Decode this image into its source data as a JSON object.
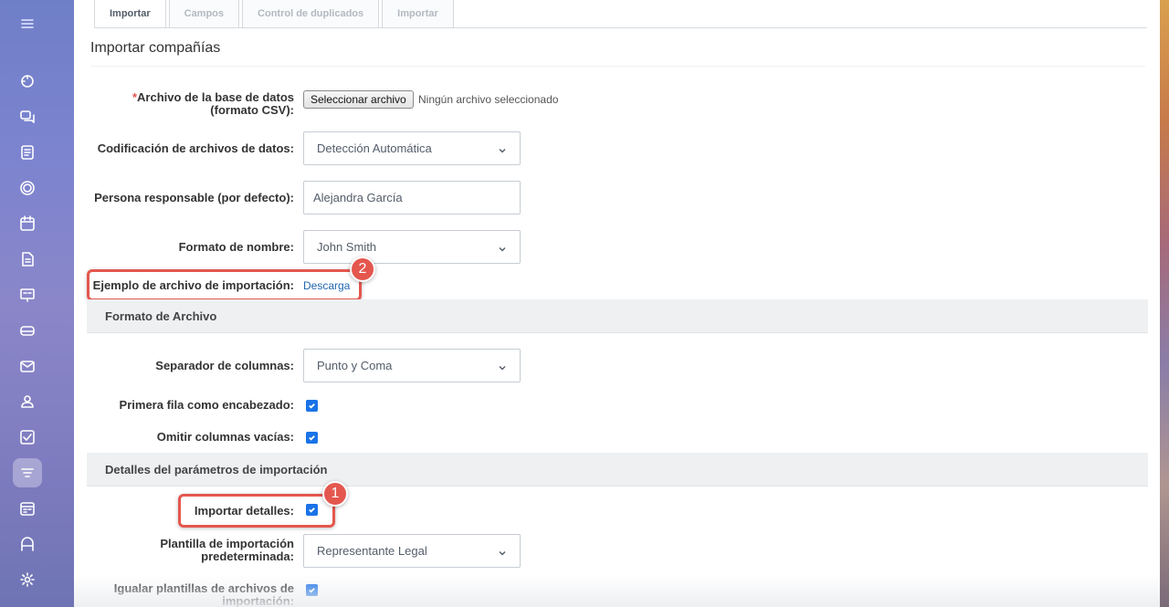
{
  "tabs": [
    {
      "label": "Importar",
      "active": true
    },
    {
      "label": "Campos",
      "active": false
    },
    {
      "label": "Control de duplicados",
      "active": false
    },
    {
      "label": "Importar",
      "active": false
    }
  ],
  "page_title": "Importar compañías",
  "form": {
    "file": {
      "required_mark": "*",
      "label_line1": "Archivo de la base de datos",
      "label_line2": "(formato CSV):",
      "button_label": "Seleccionar archivo",
      "status": "Ningún archivo seleccionado"
    },
    "encoding": {
      "label": "Codificación de archivos de datos:",
      "value": "Detección Automática"
    },
    "responsible": {
      "label": "Persona responsable (por defecto):",
      "value": "Alejandra García"
    },
    "name_format": {
      "label": "Formato de nombre:",
      "value": "John Smith"
    },
    "example": {
      "label": "Ejemplo de archivo de importación:",
      "link": "Descarga"
    }
  },
  "sections": {
    "file_format": "Formato de Archivo",
    "details": "Detalles del parámetros de importación"
  },
  "file_format": {
    "separator": {
      "label": "Separador de columnas:",
      "value": "Punto y Coma"
    },
    "first_row_header": {
      "label": "Primera fila como encabezado:",
      "checked": true
    },
    "skip_empty": {
      "label": "Omitir columnas vacías:",
      "checked": true
    }
  },
  "details": {
    "import_details": {
      "label": "Importar detalles:",
      "checked": true
    },
    "default_template": {
      "label_line1": "Plantilla de importación",
      "label_line2": "predeterminada:",
      "value": "Representante Legal"
    },
    "match_templates": {
      "label_line1": "Igualar plantillas de archivos de",
      "label_line2": "importación:",
      "checked": true
    }
  },
  "annotations": [
    {
      "number": "1",
      "color": "#e4574e"
    },
    {
      "number": "2",
      "color": "#e4574e"
    }
  ],
  "sidebar_icons": [
    "menu-icon",
    "activity-icon",
    "chat-icon",
    "feed-icon",
    "tasks-icon",
    "calendar-icon",
    "document-icon",
    "presentation-icon",
    "drive-icon",
    "mail-icon",
    "contacts-icon",
    "checklist-icon",
    "crm-filter-icon",
    "schedule-icon",
    "sites-icon",
    "settings-icon"
  ]
}
